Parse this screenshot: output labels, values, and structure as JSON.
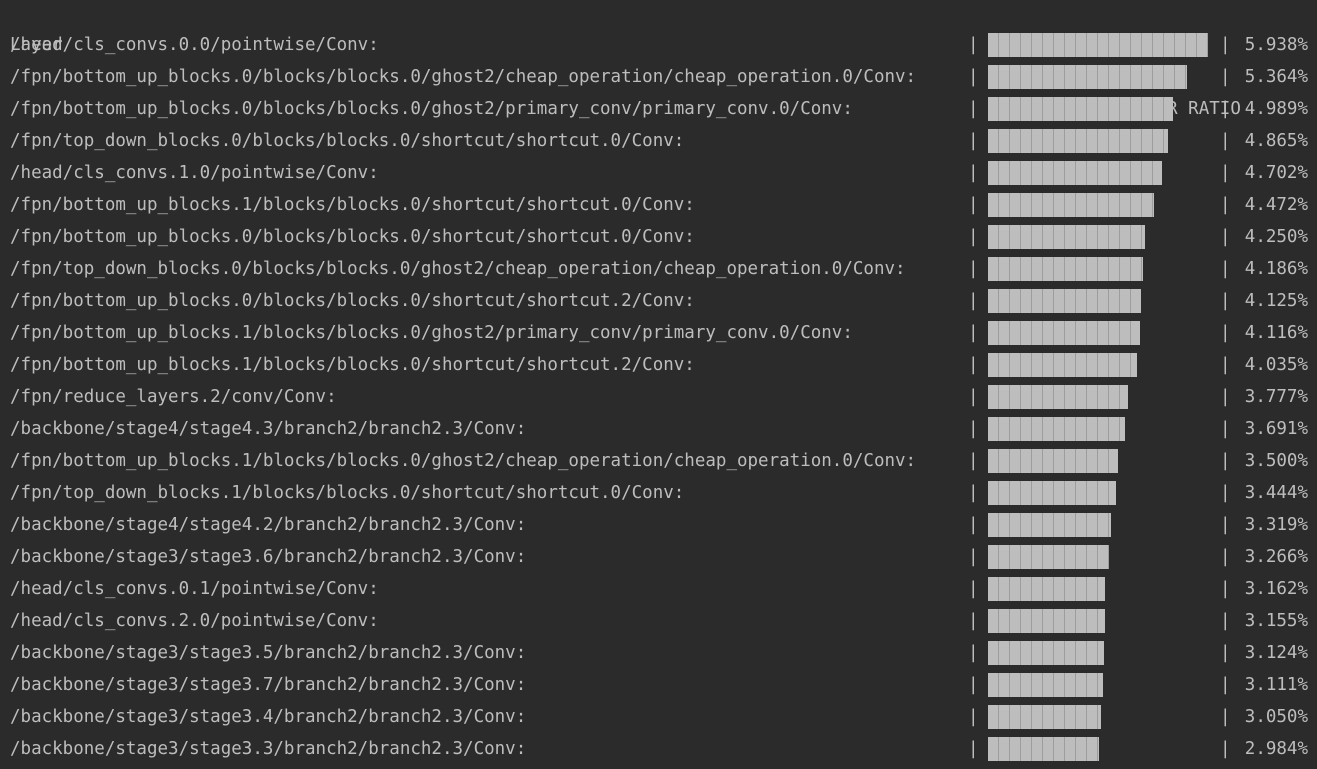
{
  "header": {
    "layer_label": "Layer",
    "separator": "|",
    "ratio_label": "NOISE:SIGNAL POWER RATIO"
  },
  "colors": {
    "background": "#2b2b2b",
    "text": "#bdbdbd",
    "bar": "#bdbdbd"
  },
  "scale_max_percent": 5.938,
  "rows": [
    {
      "layer": "/head/cls_convs.0.0/pointwise/Conv:",
      "value": 5.938,
      "pct": "5.938%"
    },
    {
      "layer": "/fpn/bottom_up_blocks.0/blocks/blocks.0/ghost2/cheap_operation/cheap_operation.0/Conv:",
      "value": 5.364,
      "pct": "5.364%"
    },
    {
      "layer": "/fpn/bottom_up_blocks.0/blocks/blocks.0/ghost2/primary_conv/primary_conv.0/Conv:",
      "value": 4.989,
      "pct": "4.989%"
    },
    {
      "layer": "/fpn/top_down_blocks.0/blocks/blocks.0/shortcut/shortcut.0/Conv:",
      "value": 4.865,
      "pct": "4.865%"
    },
    {
      "layer": "/head/cls_convs.1.0/pointwise/Conv:",
      "value": 4.702,
      "pct": "4.702%"
    },
    {
      "layer": "/fpn/bottom_up_blocks.1/blocks/blocks.0/shortcut/shortcut.0/Conv:",
      "value": 4.472,
      "pct": "4.472%"
    },
    {
      "layer": "/fpn/bottom_up_blocks.0/blocks/blocks.0/shortcut/shortcut.0/Conv:",
      "value": 4.25,
      "pct": "4.250%"
    },
    {
      "layer": "/fpn/top_down_blocks.0/blocks/blocks.0/ghost2/cheap_operation/cheap_operation.0/Conv:",
      "value": 4.186,
      "pct": "4.186%"
    },
    {
      "layer": "/fpn/bottom_up_blocks.0/blocks/blocks.0/shortcut/shortcut.2/Conv:",
      "value": 4.125,
      "pct": "4.125%"
    },
    {
      "layer": "/fpn/bottom_up_blocks.1/blocks/blocks.0/ghost2/primary_conv/primary_conv.0/Conv:",
      "value": 4.116,
      "pct": "4.116%"
    },
    {
      "layer": "/fpn/bottom_up_blocks.1/blocks/blocks.0/shortcut/shortcut.2/Conv:",
      "value": 4.035,
      "pct": "4.035%"
    },
    {
      "layer": "/fpn/reduce_layers.2/conv/Conv:",
      "value": 3.777,
      "pct": "3.777%"
    },
    {
      "layer": "/backbone/stage4/stage4.3/branch2/branch2.3/Conv:",
      "value": 3.691,
      "pct": "3.691%"
    },
    {
      "layer": "/fpn/bottom_up_blocks.1/blocks/blocks.0/ghost2/cheap_operation/cheap_operation.0/Conv:",
      "value": 3.5,
      "pct": "3.500%"
    },
    {
      "layer": "/fpn/top_down_blocks.1/blocks/blocks.0/shortcut/shortcut.0/Conv:",
      "value": 3.444,
      "pct": "3.444%"
    },
    {
      "layer": "/backbone/stage4/stage4.2/branch2/branch2.3/Conv:",
      "value": 3.319,
      "pct": "3.319%"
    },
    {
      "layer": "/backbone/stage3/stage3.6/branch2/branch2.3/Conv:",
      "value": 3.266,
      "pct": "3.266%"
    },
    {
      "layer": "/head/cls_convs.0.1/pointwise/Conv:",
      "value": 3.162,
      "pct": "3.162%"
    },
    {
      "layer": "/head/cls_convs.2.0/pointwise/Conv:",
      "value": 3.155,
      "pct": "3.155%"
    },
    {
      "layer": "/backbone/stage3/stage3.5/branch2/branch2.3/Conv:",
      "value": 3.124,
      "pct": "3.124%"
    },
    {
      "layer": "/backbone/stage3/stage3.7/branch2/branch2.3/Conv:",
      "value": 3.111,
      "pct": "3.111%"
    },
    {
      "layer": "/backbone/stage3/stage3.4/branch2/branch2.3/Conv:",
      "value": 3.05,
      "pct": "3.050%"
    },
    {
      "layer": "/backbone/stage3/stage3.3/branch2/branch2.3/Conv:",
      "value": 2.984,
      "pct": "2.984%"
    }
  ]
}
